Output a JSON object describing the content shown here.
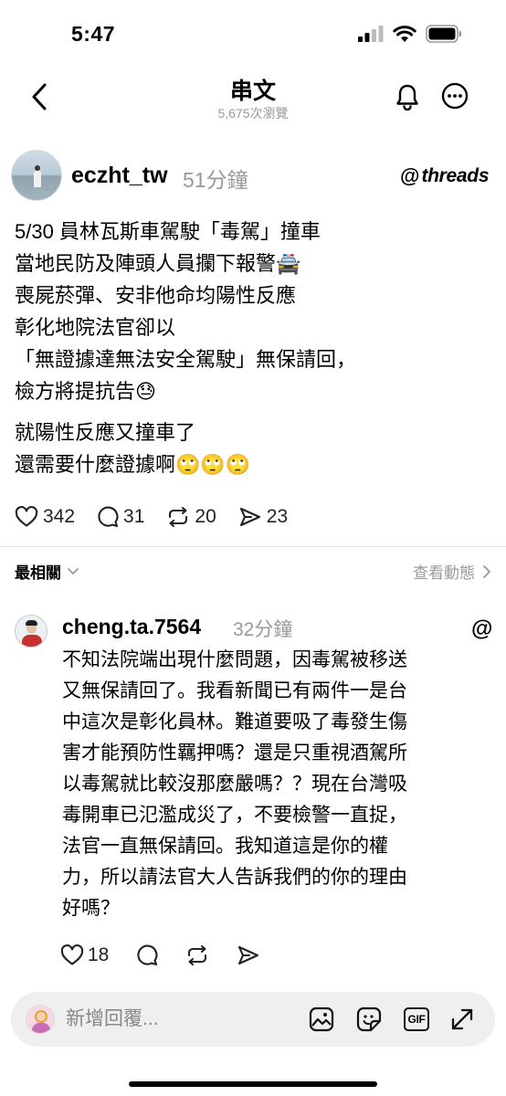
{
  "status_bar": {
    "time": "5:47"
  },
  "nav": {
    "title": "串文",
    "views": "5,675次瀏覽"
  },
  "post": {
    "username": "eczht_tw",
    "time": "51分鐘",
    "brand": "threads",
    "brand_glyph": "@",
    "lines": [
      "5/30 員林瓦斯車駕駛「毒駕」撞車",
      "當地民防及陣頭人員攔下報警🚔",
      "喪屍菸彈、安非他命均陽性反應",
      "彰化地院法官卻以",
      "「無證據達無法安全駕駛」無保請回，",
      "檢方將提抗告😓"
    ],
    "lines2": [
      "就陽性反應又撞車了",
      "還需要什麼證據啊🙄🙄🙄"
    ],
    "likes": "342",
    "comments": "31",
    "reposts": "20",
    "shares": "23"
  },
  "sort": {
    "label": "最相關",
    "activity": "查看動態"
  },
  "reply": {
    "username": "cheng.ta.7564",
    "time": "32分鐘",
    "brand_glyph": "@",
    "lines": [
      "不知法院端出現什麼問題，因毒駕被移送",
      "又無保請回了。我看新聞已有兩件一是台",
      "中這次是彰化員林。難道要吸了毒發生傷",
      "害才能預防性羈押嗎？還是只重視酒駕所",
      "以毒駕就比較沒那麼嚴嗎？？現在台灣吸",
      "毒開車已氾濫成災了，不要檢警一直捉，",
      "法官一直無保請回。我知道這是你的權",
      "力，所以請法官大人告訴我們的你的理由",
      "好嗎？"
    ],
    "likes": "18"
  },
  "composer": {
    "placeholder": "新增回覆...",
    "gif_label": "GIF"
  }
}
